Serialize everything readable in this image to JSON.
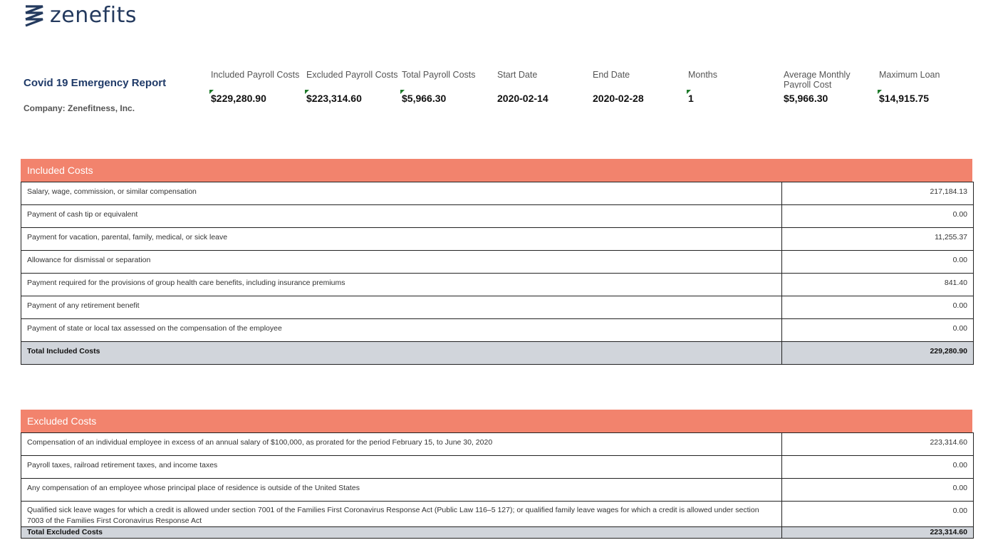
{
  "brand": {
    "name": "zenefits"
  },
  "report": {
    "title": "Covid 19 Emergency Report",
    "company": "Company: Zenefitness, Inc."
  },
  "metrics": [
    {
      "label": "Included Payroll Costs",
      "value": "$229,280.90",
      "flag": true
    },
    {
      "label": "Excluded Payroll Costs",
      "value": "$223,314.60",
      "flag": true
    },
    {
      "label": "Total Payroll Costs",
      "value": "$5,966.30",
      "flag": true
    },
    {
      "label": "Start Date",
      "value": "2020-02-14",
      "flag": false
    },
    {
      "label": "End Date",
      "value": "2020-02-28",
      "flag": false
    },
    {
      "label": "Months",
      "value": "1",
      "flag": true
    },
    {
      "label": "Average Monthly Payroll Cost",
      "value": "$5,966.30",
      "flag": false
    },
    {
      "label": "Maximum Loan",
      "value": "$14,915.75",
      "flag": true
    }
  ],
  "included": {
    "heading": "Included Costs",
    "rows": [
      {
        "label": "Salary, wage, commission, or similar compensation",
        "amount": "217,184.13"
      },
      {
        "label": "Payment of cash tip or equivalent",
        "amount": "0.00"
      },
      {
        "label": "Payment for vacation, parental, family, medical, or sick leave",
        "amount": "11,255.37"
      },
      {
        "label": "Allowance for dismissal or separation",
        "amount": "0.00"
      },
      {
        "label": "Payment required for the provisions of group health care benefits, including insurance premiums",
        "amount": "841.40"
      },
      {
        "label": "Payment of any retirement benefit",
        "amount": "0.00"
      },
      {
        "label": "Payment of state or local tax assessed on the compensation of the employee",
        "amount": "0.00"
      }
    ],
    "total_label": "Total Included Costs",
    "total_amount": "229,280.90"
  },
  "excluded": {
    "heading": "Excluded Costs",
    "rows": [
      {
        "label": "Compensation of an individual employee in excess of an annual salary of $100,000, as prorated for the period February 15, to June 30, 2020",
        "amount": "223,314.60"
      },
      {
        "label": "Payroll taxes, railroad retirement taxes, and income taxes",
        "amount": "0.00"
      },
      {
        "label": "Any compensation of an employee whose principal place of residence is outside of the United States",
        "amount": "0.00"
      },
      {
        "label": "Qualified sick leave wages for which a credit is allowed under section 7001 of the Families First Coronavirus Response Act (Public Law 116–5 127); or qualified family leave wages for which a credit is allowed under section 7003 of the Families First Coronavirus Response Act",
        "amount": "0.00"
      }
    ],
    "total_label": "Total Excluded Costs",
    "total_amount": "223,314.60"
  }
}
